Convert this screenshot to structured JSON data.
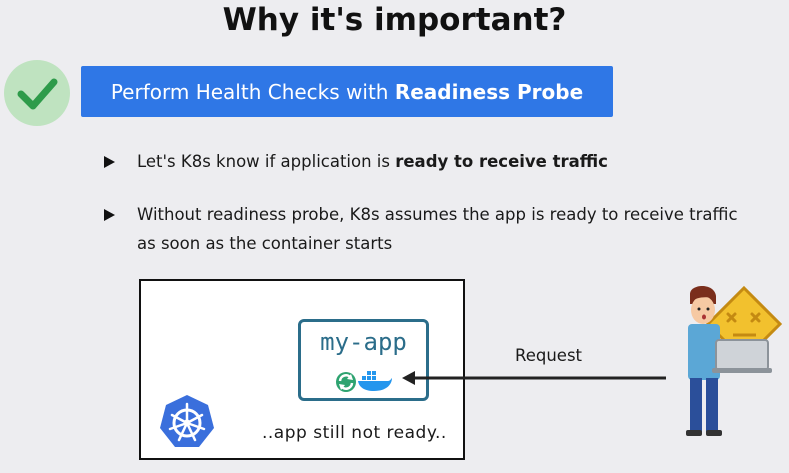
{
  "title": "Why it's important?",
  "banner": {
    "text_prefix": "Perform Health Checks with ",
    "text_bold": "Readiness Probe"
  },
  "bullets": [
    {
      "text": "Let's K8s know if application is ",
      "bold": "ready to receive traffic"
    },
    {
      "line1": "Without readiness probe, K8s assumes the app is ready to receive traffic",
      "line2": "as soon as the container starts"
    }
  ],
  "diagram": {
    "app_name": "my-app",
    "status_text": "..app still not ready..",
    "request_label": "Request"
  },
  "icons": {
    "check": "check-icon",
    "kubernetes": "kubernetes-helm-icon",
    "docker": "docker-whale-icon",
    "refresh": "refresh-icon",
    "warning": "warning-sign-icon",
    "person": "person-with-laptop-icon"
  },
  "colors": {
    "banner": "#2f77e6",
    "check_circle": "#bfe3c0",
    "check": "#2e9b4a",
    "app_border": "#2b6d8a",
    "k8s": "#3a6fdc",
    "warning": "#f2c12e"
  }
}
